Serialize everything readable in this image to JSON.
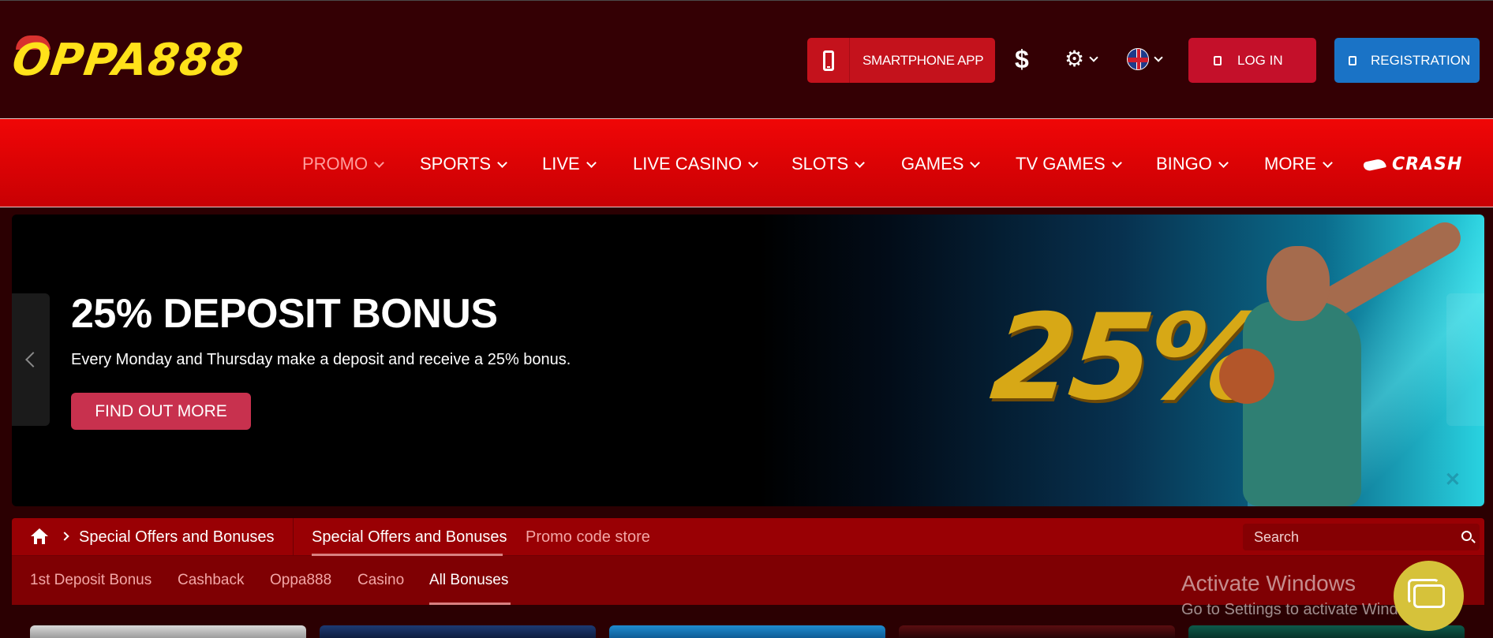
{
  "header": {
    "logo_text": "OPPA888",
    "smartphone_app_label": "SMARTPHONE APP",
    "currency_symbol": "$",
    "login_label": "LOG IN",
    "registration_label": "REGISTRATION"
  },
  "nav": {
    "items": [
      {
        "label": "PROMO",
        "active": true
      },
      {
        "label": "SPORTS"
      },
      {
        "label": "LIVE"
      },
      {
        "label": "LIVE CASINO"
      },
      {
        "label": "SLOTS"
      },
      {
        "label": "GAMES"
      },
      {
        "label": "TV GAMES"
      },
      {
        "label": "BINGO"
      },
      {
        "label": "MORE"
      }
    ],
    "crash_label": "CRASH"
  },
  "banner": {
    "title": "25% DEPOSIT BONUS",
    "subtitle": "Every Monday and Thursday make a deposit and receive a 25% bonus.",
    "cta_label": "FIND OUT MORE",
    "art_text": "25%"
  },
  "breadcrumb": {
    "current": "Special Offers and Bonuses"
  },
  "tabs": [
    {
      "label": "Special Offers and Bonuses",
      "active": true
    },
    {
      "label": "Promo code store",
      "active": false
    }
  ],
  "search": {
    "placeholder": "Search"
  },
  "subtabs": [
    {
      "label": "1st Deposit Bonus"
    },
    {
      "label": "Cashback"
    },
    {
      "label": "Oppa888"
    },
    {
      "label": "Casino"
    },
    {
      "label": "All Bonuses",
      "active": true
    }
  ],
  "overlay": {
    "activate_title": "Activate Windows",
    "activate_sub": "Go to Settings to activate Windows."
  },
  "icons": {
    "phone": "phone-icon",
    "settings": "gear-icon",
    "language": "flag-uk-icon",
    "home": "home-icon",
    "search": "search-icon",
    "chat": "chat-icon"
  },
  "colors": {
    "header_bg": "#340004",
    "nav_red": "#e00206",
    "login_red": "#c4102a",
    "register_blue": "#1a73c6",
    "cta_pink": "#c8314e",
    "logo_yellow": "#ffe21a"
  }
}
